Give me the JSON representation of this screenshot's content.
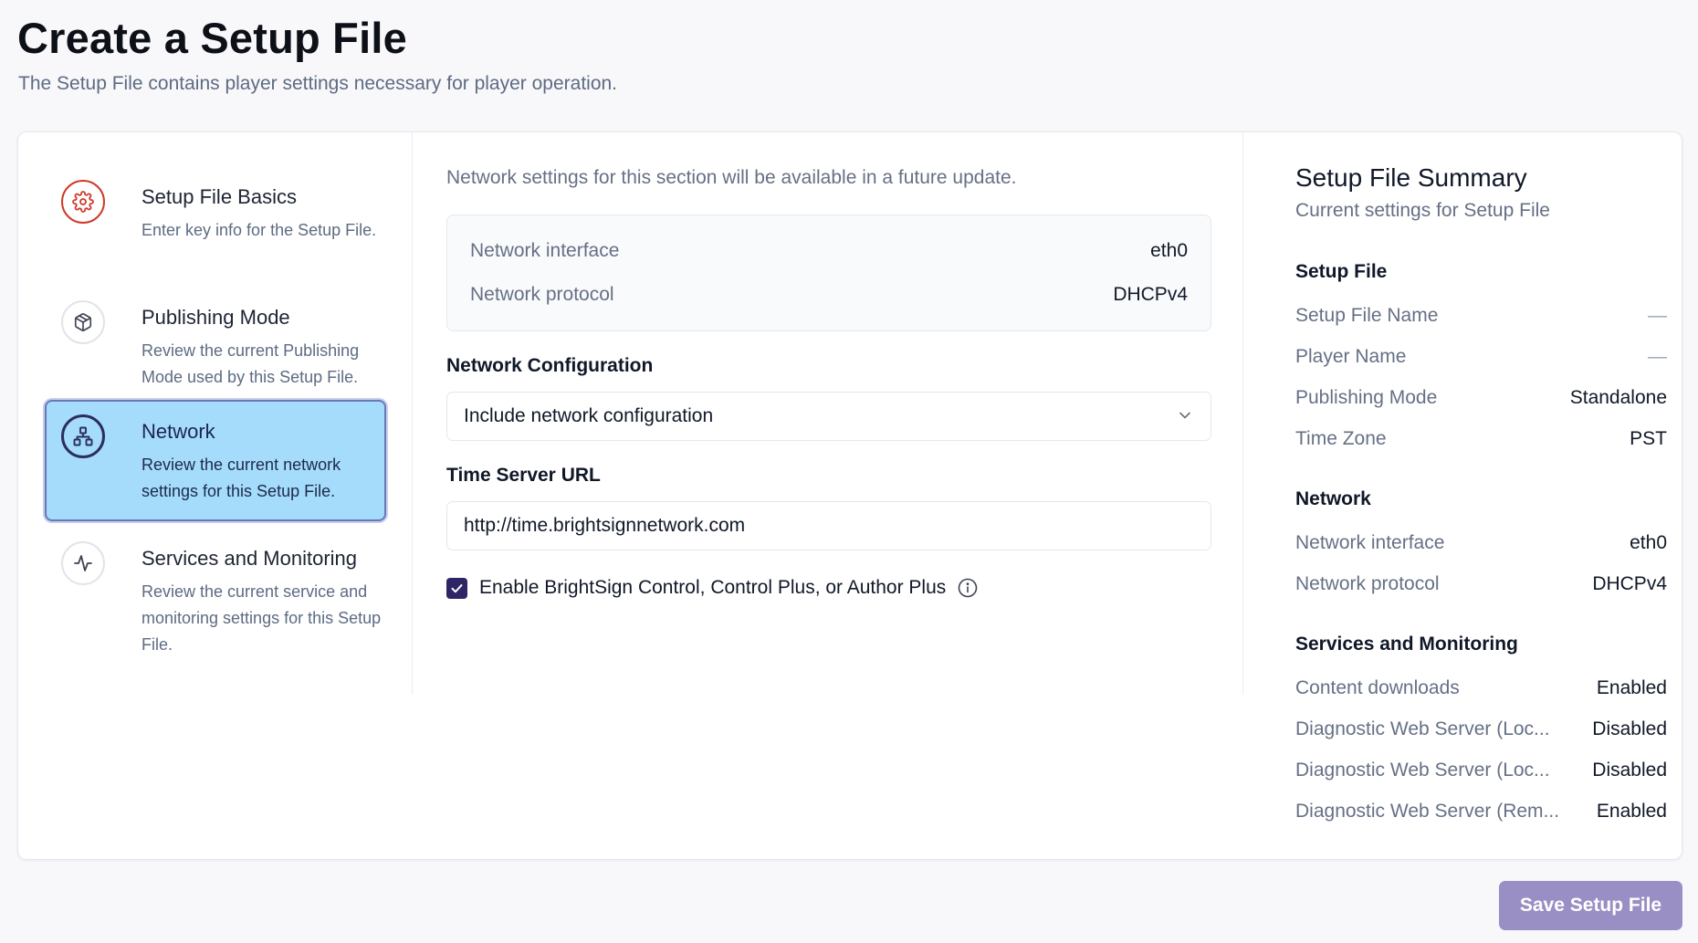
{
  "page": {
    "title": "Create a Setup File",
    "subtitle": "The Setup File contains player settings necessary for player operation."
  },
  "steps": [
    {
      "title": "Setup File Basics",
      "description": "Enter key info for the Setup File.",
      "icon": "gear-icon",
      "status": "error"
    },
    {
      "title": "Publishing Mode",
      "description": "Review the current Publishing Mode used by this Setup File.",
      "icon": "box-icon"
    },
    {
      "title": "Network",
      "description": "Review the current network settings for this Setup File.",
      "icon": "network-icon",
      "active": true
    },
    {
      "title": "Services and Monitoring",
      "description": "Review the current service and monitoring settings for this Setup File.",
      "icon": "activity-icon"
    }
  ],
  "network": {
    "note": "Network settings for this section will be available in a future update.",
    "info": [
      {
        "label": "Network interface",
        "value": "eth0"
      },
      {
        "label": "Network protocol",
        "value": "DHCPv4"
      }
    ],
    "config_label": "Network Configuration",
    "config_value": "Include network configuration",
    "time_server_label": "Time Server URL",
    "time_server_value": "http://time.brightsignnetwork.com",
    "enable_control_label": "Enable BrightSign Control, Control Plus, or Author Plus",
    "enable_control_checked": true
  },
  "summary": {
    "title": "Setup File Summary",
    "subtitle": "Current settings for Setup File",
    "sections": [
      {
        "heading": "Setup File",
        "rows": [
          {
            "label": "Setup File Name",
            "value": "—"
          },
          {
            "label": "Player Name",
            "value": "—"
          },
          {
            "label": "Publishing Mode",
            "value": "Standalone"
          },
          {
            "label": "Time Zone",
            "value": "PST"
          }
        ]
      },
      {
        "heading": "Network",
        "rows": [
          {
            "label": "Network interface",
            "value": "eth0"
          },
          {
            "label": "Network protocol",
            "value": "DHCPv4"
          }
        ]
      },
      {
        "heading": "Services and Monitoring",
        "rows": [
          {
            "label": "Content downloads",
            "value": "Enabled"
          },
          {
            "label": "Diagnostic Web Server (Loc...",
            "value": "Disabled"
          },
          {
            "label": "Diagnostic Web Server (Loc...",
            "value": "Disabled"
          },
          {
            "label": "Diagnostic Web Server (Rem...",
            "value": "Enabled"
          }
        ]
      }
    ]
  },
  "actions": {
    "save_label": "Save Setup File"
  },
  "colors": {
    "accent": "#2e2566",
    "active_step_bg": "#a5dcfb",
    "error": "#d03a2b",
    "save_button": "#9a8fc4"
  }
}
